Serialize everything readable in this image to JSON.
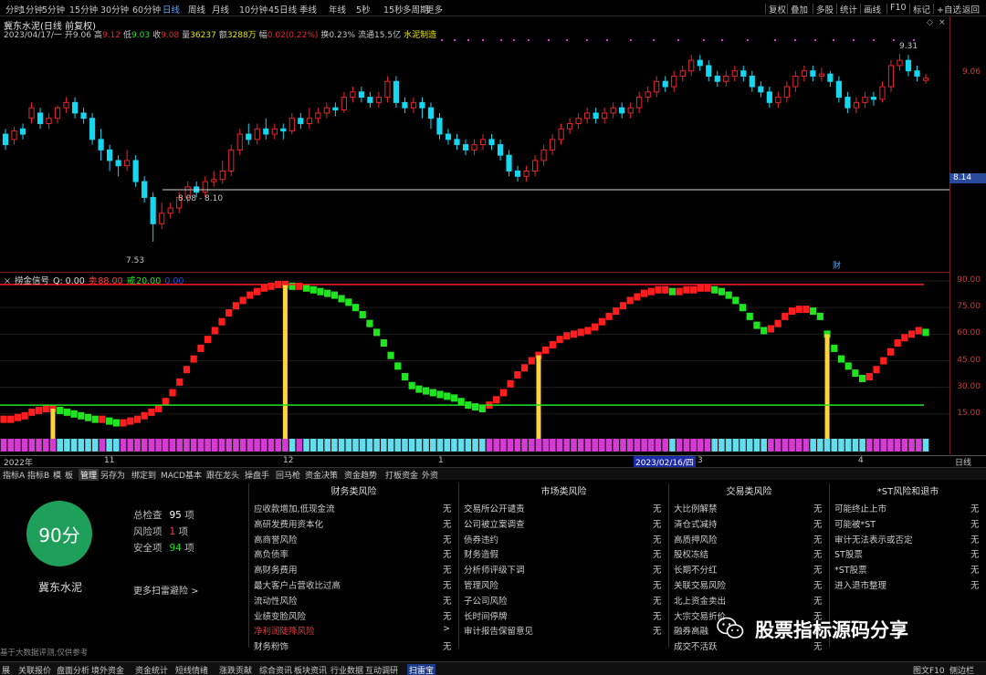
{
  "toolbar": {
    "periods": [
      "分时",
      "1分钟",
      "5分钟",
      "15分钟",
      "30分钟",
      "60分钟",
      "日线",
      "周线",
      "月线",
      "10分钟",
      "45日线",
      "季线",
      "年线",
      "5秒",
      "15秒",
      "多周期",
      "更多"
    ],
    "active_period": "日线",
    "right_buttons": [
      "复权",
      "叠加",
      "多股",
      "统计",
      "画线",
      "F10",
      "标记",
      "+自选",
      "返回"
    ]
  },
  "stock": {
    "title": "冀东水泥(日线 前复权)",
    "name": "冀东水泥"
  },
  "quote": {
    "date": "2023/04/17/一",
    "open_label": "开",
    "open": "9.06",
    "high_label": "高",
    "high": "9.12",
    "low_label": "低",
    "low": "9.03",
    "close_label": "收",
    "close": "9.08",
    "volume_label": "量",
    "volume": "36237",
    "amount_label": "额",
    "amount": "3288万",
    "change_label": "幅",
    "change": "0.02(0.22%)",
    "turnover_label": "换",
    "turnover": "0.23%",
    "float_label": "流通",
    "float_cap": "15.5亿",
    "sector": "水泥制造"
  },
  "price_axis": {
    "labels": [
      "9.06"
    ],
    "current_tag": "8.14"
  },
  "annotations": {
    "high": "9.31",
    "low": "7.53",
    "range": "8.08 - 8.10",
    "fin_marker": "财"
  },
  "indicator": {
    "name": "捞金信号",
    "q_label": "Q: 0.00",
    "sell_label": "卖",
    "sell_value": "88.00",
    "buy_label": "戒",
    "buy_value": "20.00",
    "extra": "0.00"
  },
  "indicator_axis": {
    "labels": [
      "90.00",
      "75.00",
      "60.00",
      "45.00",
      "30.00",
      "15.00"
    ]
  },
  "dates": {
    "labels": [
      "2022年",
      "11",
      "12",
      "1",
      "2023/02/16/四",
      "3",
      "4"
    ],
    "highlight": "2023/02/16/四",
    "right_label": "日线"
  },
  "colors": {
    "up": "#e8262b",
    "down": "#17d6f0",
    "buy_bar": "#1fe51f",
    "sell_bar": "#ff1d1d",
    "signal": "#ffd33a",
    "magenta": "#d53bd3",
    "cyan_bar": "#63dcec"
  },
  "chart_data": [
    {
      "type": "candlestick",
      "name": "冀东水泥 日线",
      "ylim": [
        7.4,
        9.45
      ],
      "candles": [
        [
          8.55,
          8.45,
          8.6,
          8.4
        ],
        [
          8.5,
          8.58,
          8.62,
          8.45
        ],
        [
          8.6,
          8.55,
          8.65,
          8.5
        ],
        [
          8.7,
          8.8,
          8.85,
          8.65
        ],
        [
          8.75,
          8.65,
          8.8,
          8.6
        ],
        [
          8.65,
          8.7,
          8.75,
          8.6
        ],
        [
          8.7,
          8.8,
          8.82,
          8.65
        ],
        [
          8.8,
          8.85,
          8.9,
          8.75
        ],
        [
          8.85,
          8.75,
          8.9,
          8.7
        ],
        [
          8.75,
          8.7,
          8.8,
          8.65
        ],
        [
          8.7,
          8.5,
          8.75,
          8.45
        ],
        [
          8.5,
          8.4,
          8.6,
          8.3
        ],
        [
          8.4,
          8.3,
          8.45,
          8.2
        ],
        [
          8.3,
          8.25,
          8.35,
          8.15
        ],
        [
          8.25,
          8.3,
          8.4,
          8.2
        ],
        [
          8.3,
          8.1,
          8.35,
          8.05
        ],
        [
          8.1,
          7.95,
          8.15,
          7.9
        ],
        [
          7.95,
          7.7,
          8.0,
          7.53
        ],
        [
          7.7,
          7.8,
          7.9,
          7.65
        ],
        [
          7.8,
          7.85,
          7.9,
          7.75
        ],
        [
          7.85,
          7.95,
          8.0,
          7.8
        ],
        [
          7.95,
          8.05,
          8.1,
          7.9
        ],
        [
          8.05,
          8.0,
          8.1,
          7.95
        ],
        [
          8.0,
          8.1,
          8.15,
          7.95
        ],
        [
          8.1,
          8.12,
          8.2,
          8.05
        ],
        [
          8.12,
          8.2,
          8.3,
          8.08
        ],
        [
          8.2,
          8.4,
          8.45,
          8.15
        ],
        [
          8.4,
          8.55,
          8.6,
          8.35
        ],
        [
          8.55,
          8.5,
          8.65,
          8.45
        ],
        [
          8.5,
          8.6,
          8.65,
          8.45
        ],
        [
          8.6,
          8.55,
          8.7,
          8.5
        ],
        [
          8.55,
          8.6,
          8.65,
          8.5
        ],
        [
          8.6,
          8.58,
          8.65,
          8.5
        ],
        [
          8.58,
          8.7,
          8.75,
          8.55
        ],
        [
          8.7,
          8.65,
          8.75,
          8.6
        ],
        [
          8.65,
          8.7,
          8.8,
          8.6
        ],
        [
          8.7,
          8.75,
          8.8,
          8.65
        ],
        [
          8.75,
          8.8,
          8.85,
          8.7
        ],
        [
          8.8,
          8.78,
          8.85,
          8.72
        ],
        [
          8.78,
          8.9,
          8.95,
          8.75
        ],
        [
          8.9,
          8.95,
          9.0,
          8.85
        ],
        [
          8.95,
          8.9,
          9.0,
          8.85
        ],
        [
          8.9,
          8.85,
          8.95,
          8.8
        ],
        [
          8.85,
          8.9,
          8.95,
          8.8
        ],
        [
          8.9,
          9.05,
          9.1,
          8.85
        ],
        [
          9.05,
          8.85,
          9.1,
          8.8
        ],
        [
          8.85,
          8.8,
          8.9,
          8.75
        ],
        [
          8.8,
          8.85,
          8.9,
          8.75
        ],
        [
          8.85,
          8.8,
          8.9,
          8.7
        ],
        [
          8.8,
          8.7,
          8.85,
          8.6
        ],
        [
          8.7,
          8.55,
          8.75,
          8.5
        ],
        [
          8.55,
          8.5,
          8.6,
          8.45
        ],
        [
          8.5,
          8.45,
          8.55,
          8.4
        ],
        [
          8.45,
          8.4,
          8.5,
          8.35
        ],
        [
          8.4,
          8.45,
          8.5,
          8.35
        ],
        [
          8.45,
          8.5,
          8.55,
          8.4
        ],
        [
          8.5,
          8.45,
          8.55,
          8.4
        ],
        [
          8.45,
          8.35,
          8.5,
          8.3
        ],
        [
          8.35,
          8.2,
          8.4,
          8.15
        ],
        [
          8.2,
          8.15,
          8.25,
          8.1
        ],
        [
          8.15,
          8.2,
          8.25,
          8.1
        ],
        [
          8.2,
          8.3,
          8.35,
          8.15
        ],
        [
          8.3,
          8.4,
          8.45,
          8.25
        ],
        [
          8.4,
          8.5,
          8.55,
          8.35
        ],
        [
          8.5,
          8.6,
          8.65,
          8.45
        ],
        [
          8.6,
          8.65,
          8.7,
          8.55
        ],
        [
          8.65,
          8.7,
          8.75,
          8.6
        ],
        [
          8.7,
          8.75,
          8.8,
          8.65
        ],
        [
          8.75,
          8.7,
          8.8,
          8.65
        ],
        [
          8.7,
          8.75,
          8.8,
          8.65
        ],
        [
          8.75,
          8.8,
          8.85,
          8.7
        ],
        [
          8.8,
          8.75,
          8.85,
          8.7
        ],
        [
          8.75,
          8.8,
          8.85,
          8.7
        ],
        [
          8.8,
          8.9,
          8.95,
          8.75
        ],
        [
          8.9,
          8.95,
          9.0,
          8.85
        ],
        [
          8.95,
          9.05,
          9.1,
          8.9
        ],
        [
          9.05,
          9.0,
          9.1,
          8.95
        ],
        [
          9.0,
          9.1,
          9.15,
          8.95
        ],
        [
          9.1,
          9.15,
          9.2,
          9.05
        ],
        [
          9.15,
          9.25,
          9.3,
          9.1
        ],
        [
          9.25,
          9.2,
          9.3,
          9.15
        ],
        [
          9.2,
          9.1,
          9.25,
          9.05
        ],
        [
          9.1,
          9.05,
          9.15,
          9.0
        ],
        [
          9.05,
          9.1,
          9.15,
          9.0
        ],
        [
          9.1,
          9.15,
          9.2,
          9.05
        ],
        [
          9.15,
          9.1,
          9.2,
          9.05
        ],
        [
          9.1,
          9.0,
          9.15,
          8.95
        ],
        [
          9.0,
          8.95,
          9.05,
          8.9
        ],
        [
          8.95,
          8.85,
          9.0,
          8.8
        ],
        [
          8.85,
          8.9,
          8.95,
          8.8
        ],
        [
          8.9,
          9.0,
          9.05,
          8.85
        ],
        [
          9.0,
          9.1,
          9.15,
          8.95
        ],
        [
          9.1,
          9.15,
          9.2,
          9.05
        ],
        [
          9.15,
          9.1,
          9.2,
          9.05
        ],
        [
          9.1,
          9.12,
          9.18,
          9.05
        ],
        [
          9.12,
          9.05,
          9.15,
          9.0
        ],
        [
          9.05,
          8.9,
          9.1,
          8.85
        ],
        [
          8.9,
          8.8,
          8.95,
          8.75
        ],
        [
          8.8,
          8.85,
          8.9,
          8.75
        ],
        [
          8.85,
          8.9,
          8.95,
          8.8
        ],
        [
          8.9,
          8.88,
          8.95,
          8.82
        ],
        [
          8.88,
          9.0,
          9.05,
          8.85
        ],
        [
          9.0,
          9.2,
          9.25,
          8.95
        ],
        [
          9.2,
          9.25,
          9.31,
          9.15
        ],
        [
          9.25,
          9.15,
          9.3,
          9.1
        ],
        [
          9.15,
          9.1,
          9.2,
          9.05
        ],
        [
          9.06,
          9.08,
          9.12,
          9.03
        ]
      ]
    },
    {
      "type": "bar",
      "name": "捞金信号",
      "ylim": [
        0,
        90
      ],
      "reference_lines": [
        88,
        20
      ],
      "values": [
        12,
        12,
        13,
        14,
        16,
        17,
        18,
        18,
        17,
        16,
        15,
        14,
        13,
        12,
        12,
        11,
        10,
        10,
        11,
        12,
        14,
        16,
        18,
        22,
        27,
        33,
        40,
        46,
        52,
        57,
        62,
        67,
        72,
        76,
        79,
        82,
        84,
        86,
        87,
        88,
        88,
        87,
        87,
        86,
        85,
        84,
        83,
        82,
        80,
        78,
        75,
        71,
        66,
        61,
        55,
        48,
        42,
        36,
        31,
        29,
        28,
        27,
        26,
        25,
        24,
        22,
        20,
        19,
        18,
        20,
        23,
        27,
        32,
        37,
        41,
        45,
        48,
        51,
        54,
        57,
        59,
        60,
        61,
        62,
        64,
        67,
        70,
        73,
        76,
        79,
        81,
        83,
        84,
        85,
        85,
        84,
        84,
        85,
        85,
        86,
        86,
        85,
        84,
        82,
        79,
        75,
        70,
        65,
        62,
        63,
        66,
        70,
        73,
        74,
        74,
        73,
        70,
        60,
        52,
        46,
        42,
        38,
        35,
        36,
        40,
        45,
        50,
        55,
        58,
        60,
        62,
        61
      ],
      "signals": [
        7,
        40,
        76,
        117,
        132
      ]
    }
  ],
  "risk": {
    "score": "90分",
    "total_label": "总检查",
    "total": "95",
    "total_unit": "项",
    "risk_label": "风险项",
    "risk_count": "1",
    "risk_unit": "项",
    "safe_label": "安全项",
    "safe_count": "94",
    "safe_unit": "项",
    "more": "更多扫雷避险 >",
    "disclaimer": "基于大数据评测,仅供参考",
    "columns": [
      {
        "title": "财务类风险",
        "items": [
          {
            "label": "应收款增加,低现金流",
            "status": "无"
          },
          {
            "label": "高研发费用资本化",
            "status": "无"
          },
          {
            "label": "高商誉风险",
            "status": "无"
          },
          {
            "label": "高负债率",
            "status": "无"
          },
          {
            "label": "高财务费用",
            "status": "无"
          },
          {
            "label": "最大客户占营收比过高",
            "status": "无"
          },
          {
            "label": "流动性风险",
            "status": "无"
          },
          {
            "label": "业绩变脸风险",
            "status": "无"
          },
          {
            "label": "净利润陡降风险",
            "status": ">",
            "flag": true
          },
          {
            "label": "财务粉饰",
            "status": "无"
          }
        ]
      },
      {
        "title": "市场类风险",
        "items": [
          {
            "label": "交易所公开谴责",
            "status": "无"
          },
          {
            "label": "公司被立案调查",
            "status": "无"
          },
          {
            "label": "债券违约",
            "status": "无"
          },
          {
            "label": "财务造假",
            "status": "无"
          },
          {
            "label": "分析师评级下调",
            "status": "无"
          },
          {
            "label": "管理风险",
            "status": "无"
          },
          {
            "label": "子公司风险",
            "status": "无"
          },
          {
            "label": "长时间停牌",
            "status": "无"
          },
          {
            "label": "审计报告保留意见",
            "status": "无"
          }
        ]
      },
      {
        "title": "交易类风险",
        "items": [
          {
            "label": "大比例解禁",
            "status": "无"
          },
          {
            "label": "清仓式减持",
            "status": "无"
          },
          {
            "label": "高质押风险",
            "status": "无"
          },
          {
            "label": "股权冻结",
            "status": "无"
          },
          {
            "label": "长期不分红",
            "status": "无"
          },
          {
            "label": "关联交易风险",
            "status": "无"
          },
          {
            "label": "北上资金卖出",
            "status": "无"
          },
          {
            "label": "大宗交易折价",
            "status": "无"
          },
          {
            "label": "融券高融",
            "status": "无"
          },
          {
            "label": "成交不活跃",
            "status": "无"
          }
        ]
      },
      {
        "title": "*ST风险和退市",
        "items": [
          {
            "label": "可能终止上市",
            "status": "无"
          },
          {
            "label": "可能被*ST",
            "status": "无"
          },
          {
            "label": "审计无法表示或否定",
            "status": "无"
          },
          {
            "label": "ST股票",
            "status": "无"
          },
          {
            "label": "*ST股票",
            "status": "无"
          },
          {
            "label": "进入退市整理",
            "status": "无"
          }
        ]
      }
    ]
  },
  "sub_tabs": [
    "指标A",
    "指标B",
    "模",
    "板",
    "管理",
    "另存为",
    "绑定到",
    "MACD基本",
    "跟在龙头",
    "操盘手",
    "回马枪",
    "资金决策",
    "资金趋势",
    "打板资金",
    "外资"
  ],
  "active_sub_tab": "管理",
  "bottom_tabs": [
    "展",
    "关联报价",
    "盘面分析",
    "境外资金",
    "资金统计",
    "短线情绪",
    "涨跌贡献",
    "综合资讯",
    "板块资讯",
    "行业数据",
    "互动调研",
    "扫雷宝"
  ],
  "active_bottom_tab": "扫雷宝",
  "bottom_right": [
    "图文F10",
    "侧边栏"
  ],
  "watermark": "股票指标源码分享"
}
